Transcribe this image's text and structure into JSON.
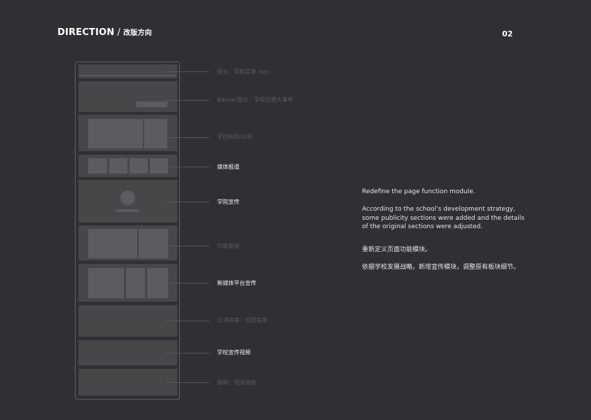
{
  "header": {
    "title": "DIRECTION",
    "separator": "/",
    "subtitle": "改版方向",
    "page_number": "02"
  },
  "modules": [
    {
      "id": "header",
      "label": "版头：导航菜单 logo",
      "highlight": false
    },
    {
      "id": "banner",
      "label": "Banner展示：学校近期大事件",
      "highlight": false
    },
    {
      "id": "news",
      "label": "学校新闻/公告",
      "highlight": false
    },
    {
      "id": "media",
      "label": "媒体报道",
      "highlight": true
    },
    {
      "id": "college",
      "label": "学院宣传",
      "highlight": true
    },
    {
      "id": "links",
      "label": "功能链接",
      "highlight": false
    },
    {
      "id": "newmedia",
      "label": "新媒体平台宣传",
      "highlight": true
    },
    {
      "id": "story",
      "label": "北洋故事：校园美景",
      "highlight": false
    },
    {
      "id": "video",
      "label": "学校宣传视频",
      "highlight": true
    },
    {
      "id": "footer",
      "label": "版尾：相关链接",
      "highlight": false
    }
  ],
  "description": {
    "en_title": "Redefine the page function module.",
    "en_body_1": "According to the school’s development strategy,",
    "en_body_2": "some publicity sections were added and the details",
    "en_body_3": "of the original sections were adjusted.",
    "zh_title": "重新定义页面功能模块。",
    "zh_body": "依据学校发展战略，新增宣传模块，调整原有板块细节。"
  },
  "colors": {
    "background": "#2e3033",
    "block": "#464749",
    "inner": "#5b5c5f",
    "highlight_text": "#f2f2f2",
    "dim_text": "#595b5f"
  }
}
